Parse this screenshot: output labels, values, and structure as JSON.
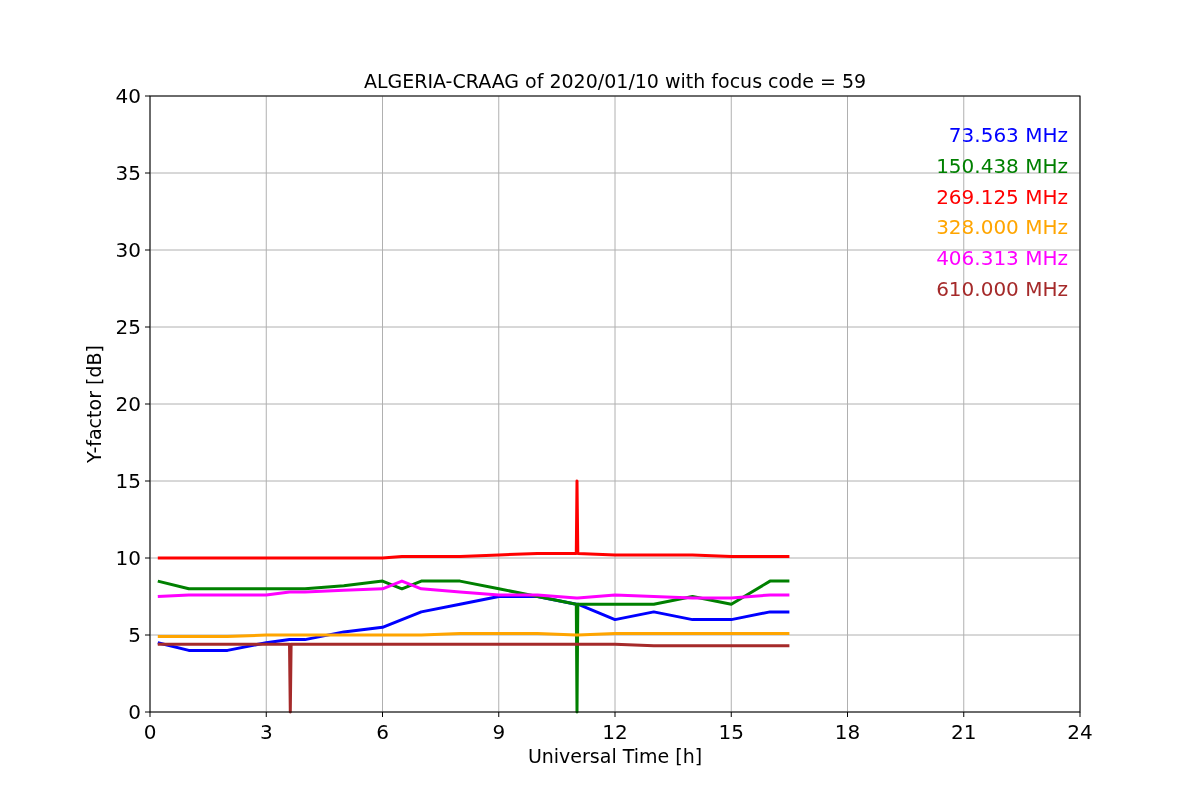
{
  "chart_data": {
    "type": "line",
    "title": "ALGERIA-CRAAG of 2020/01/10 with focus code = 59",
    "xlabel": "Universal Time [h]",
    "ylabel": "Y-factor [dB]",
    "x": [
      0.2,
      1,
      2,
      3,
      3.6,
      3.62,
      3.64,
      4,
      5,
      6,
      6.5,
      7,
      8,
      9,
      10,
      11,
      11.02,
      11.04,
      12,
      13,
      14,
      15,
      16,
      16.5
    ],
    "series": [
      {
        "name": "73.563 MHz",
        "color": "#0000ff",
        "values": [
          4.5,
          4,
          4,
          4.5,
          4.7,
          4.7,
          4.7,
          4.7,
          5.2,
          5.5,
          6,
          6.5,
          7,
          7.5,
          7.5,
          7,
          7,
          7,
          6,
          6.5,
          6,
          6,
          6.5,
          6.5
        ]
      },
      {
        "name": "150.438 MHz",
        "color": "#008000",
        "values": [
          8.5,
          8,
          8,
          8,
          8,
          8,
          8,
          8,
          8.2,
          8.5,
          8,
          8.5,
          8.5,
          8,
          7.5,
          7,
          0,
          7,
          7,
          7,
          7.5,
          7,
          8.5,
          8.5
        ]
      },
      {
        "name": "269.125 MHz",
        "color": "#ff0000",
        "values": [
          10,
          10,
          10,
          10,
          10,
          10,
          10,
          10,
          10,
          10,
          10.1,
          10.1,
          10.1,
          10.2,
          10.3,
          10.3,
          15,
          10.3,
          10.2,
          10.2,
          10.2,
          10.1,
          10.1,
          10.1
        ]
      },
      {
        "name": "328.000 MHz",
        "color": "#ffa500",
        "values": [
          4.9,
          4.9,
          4.9,
          5,
          5,
          5,
          5,
          5,
          5,
          5,
          5,
          5,
          5.1,
          5.1,
          5.1,
          5,
          5,
          5,
          5.1,
          5.1,
          5.1,
          5.1,
          5.1,
          5.1
        ]
      },
      {
        "name": "406.313 MHz",
        "color": "#ff00ff",
        "values": [
          7.5,
          7.6,
          7.6,
          7.6,
          7.8,
          7.8,
          7.8,
          7.8,
          7.9,
          8,
          8.5,
          8,
          7.8,
          7.6,
          7.6,
          7.4,
          7.4,
          7.4,
          7.6,
          7.5,
          7.4,
          7.4,
          7.6,
          7.6
        ]
      },
      {
        "name": "610.000 MHz",
        "color": "#a52a2a",
        "values": [
          4.4,
          4.4,
          4.4,
          4.4,
          4.4,
          0,
          4.4,
          4.4,
          4.4,
          4.4,
          4.4,
          4.4,
          4.4,
          4.4,
          4.4,
          4.4,
          4.4,
          4.4,
          4.4,
          4.3,
          4.3,
          4.3,
          4.3,
          4.3
        ]
      }
    ],
    "xlim": [
      0,
      24
    ],
    "ylim": [
      0,
      40
    ],
    "xticks": [
      0,
      3,
      6,
      9,
      12,
      15,
      18,
      21,
      24
    ],
    "yticks": [
      0,
      5,
      10,
      15,
      20,
      25,
      30,
      35,
      40
    ],
    "grid": true
  }
}
